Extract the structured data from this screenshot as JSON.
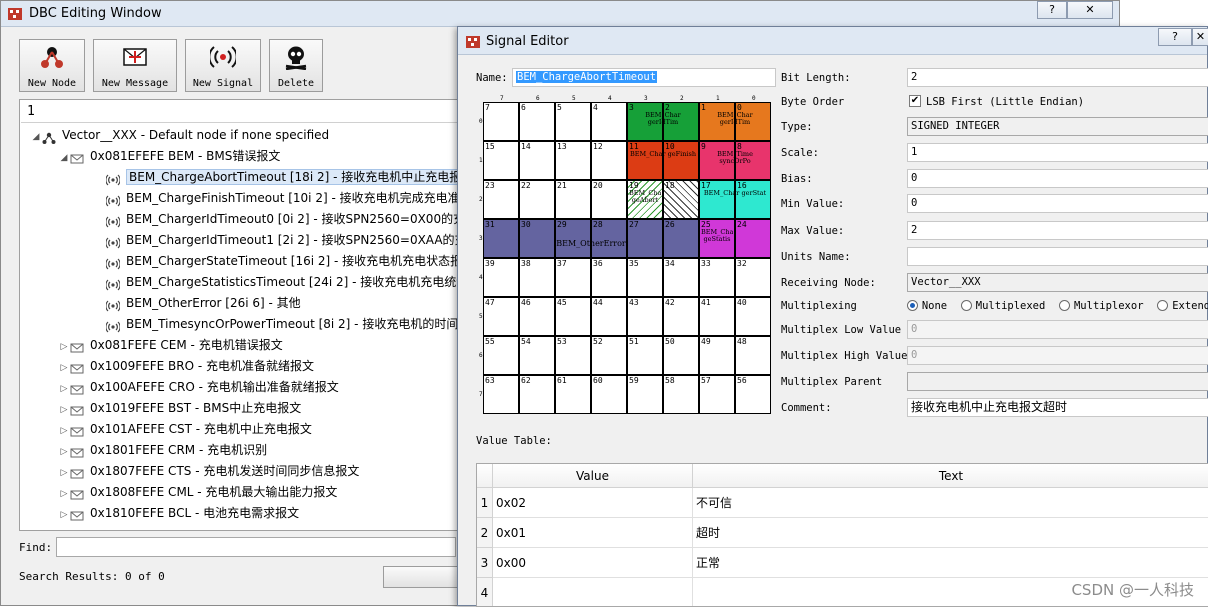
{
  "main_window": {
    "title": "DBC Editing Window",
    "help_label": "?",
    "close_label": "✕",
    "toolbar": [
      {
        "label": "New Node",
        "icon": "new-node-icon"
      },
      {
        "label": "New Message",
        "icon": "new-message-icon"
      },
      {
        "label": "New Signal",
        "icon": "new-signal-icon"
      },
      {
        "label": "Delete",
        "icon": "delete-skull-icon"
      }
    ],
    "tree_input_value": "1",
    "tree": {
      "root": "Vector__XXX - Default node if none specified",
      "expanded_message": "0x081EFEFE BEM - BMS错误报文",
      "signals": [
        "BEM_ChargeAbortTimeout [18i 2] - 接收充电机中止充电报",
        "BEM_ChargeFinishTimeout [10i 2] - 接收充电机完成充电准",
        "BEM_ChargerIdTimeout0 [0i 2] - 接收SPN2560=0X00的充",
        "BEM_ChargerIdTimeout1 [2i 2] - 接收SPN2560=0XAA的充",
        "BEM_ChargerStateTimeout [16i 2] - 接收充电机充电状态报",
        "BEM_ChargeStatisticsTimeout [24i 2] - 接收充电机充电统计",
        "BEM_OtherError [26i 6] - 其他",
        "BEM_TimesyncOrPowerTimeout [8i 2] - 接收充电机的时间同"
      ],
      "messages": [
        "0x081FEFE CEM - 充电机错误报文",
        "0x1009FEFE BRO - 充电机准备就绪报文",
        "0x100AFEFE CRO - 充电机输出准备就绪报文",
        "0x1019FEFE BST - BMS中止充电报文",
        "0x101AFEFE CST - 充电机中止充电报文",
        "0x1801FEFE CRM - 充电机识别",
        "0x1807FEFE CTS - 充电机发送时间同步信息报文",
        "0x1808FEFE CML - 充电机最大输出能力报文",
        "0x1810FEFE BCL - 电池充电需求报文"
      ]
    },
    "find_label": "Find:",
    "search_results": "Search Results: 0 of 0"
  },
  "signal_editor": {
    "title": "Signal Editor",
    "help_label": "?",
    "close_label": "✕",
    "name_label": "Name:",
    "name_value": "BEM_ChargeAbortTimeout",
    "fields": {
      "bit_length": {
        "label": "Bit Length:",
        "value": "2"
      },
      "byte_order": {
        "label": "Byte Order",
        "value": "LSB First (Little Endian)",
        "checked": true
      },
      "type": {
        "label": "Type:",
        "value": "SIGNED INTEGER"
      },
      "scale": {
        "label": "Scale:",
        "value": "1"
      },
      "bias": {
        "label": "Bias:",
        "value": "0"
      },
      "min_value": {
        "label": "Min Value:",
        "value": "0"
      },
      "max_value": {
        "label": "Max Value:",
        "value": "2"
      },
      "units_name": {
        "label": "Units Name:",
        "value": ""
      },
      "receiving_node": {
        "label": "Receiving Node:",
        "value": "Vector__XXX"
      },
      "multiplexing": {
        "label": "Multiplexing",
        "options": [
          "None",
          "Multiplexed",
          "Multiplexor",
          "Extended"
        ],
        "selected": "None"
      },
      "multiplex_low": {
        "label": "Multiplex Low Value",
        "value": "0"
      },
      "multiplex_high": {
        "label": "Multiplex High Value",
        "value": "0"
      },
      "multiplex_parent": {
        "label": "Multiplex Parent",
        "value": ""
      },
      "comment": {
        "label": "Comment:",
        "value": "接收充电机中止充电报文超时"
      }
    },
    "bit_grid": {
      "header_digits": [
        "7",
        "6",
        "5",
        "4",
        "3",
        "2",
        "1",
        "0"
      ],
      "row_digits": [
        "0",
        "1",
        "2",
        "3",
        "4",
        "5",
        "6",
        "7"
      ],
      "overlays": [
        {
          "text": "BEM_ChargerIdTimeout1",
          "short": "BEM_Char gerIdTim",
          "color": "#16a038"
        },
        {
          "text": "BEM_ChargerIdTimeout0",
          "short": "BEM_Char gerIdTim",
          "color": "#e6781e"
        },
        {
          "text": "BEM_ChargeFinishTimeout",
          "short": "BEM_Char geFinish",
          "color": "#dc3c14"
        },
        {
          "text": "BEM_TimesyncOrPowerTimeout",
          "short": "BEM_Time syncOrPo",
          "color": "#e8346c"
        },
        {
          "text": "BEM_ChargeAbortTimeout",
          "short": "BEM_Char geAbort",
          "color": "#4aa84a"
        },
        {
          "text": "BEM_ChargerStateTimeout",
          "short": "BEM_Char gerStat",
          "color": "#2ee8d0"
        },
        {
          "text": "BEM_OtherError",
          "short": "BEM_OtherError",
          "color": "#6464a0"
        },
        {
          "text": "BEM_ChargeStatisticsTimeout",
          "short": "BEM_Char geStatis",
          "color": "#d038d8"
        }
      ]
    },
    "value_table": {
      "label": "Value Table:",
      "headers": [
        "Value",
        "Text"
      ],
      "rows": [
        {
          "num": "1",
          "value": "0x02",
          "text": "不可信"
        },
        {
          "num": "2",
          "value": "0x01",
          "text": "超时"
        },
        {
          "num": "3",
          "value": "0x00",
          "text": "正常"
        },
        {
          "num": "4",
          "value": "",
          "text": ""
        }
      ]
    }
  },
  "watermark": "CSDN @一人科技"
}
